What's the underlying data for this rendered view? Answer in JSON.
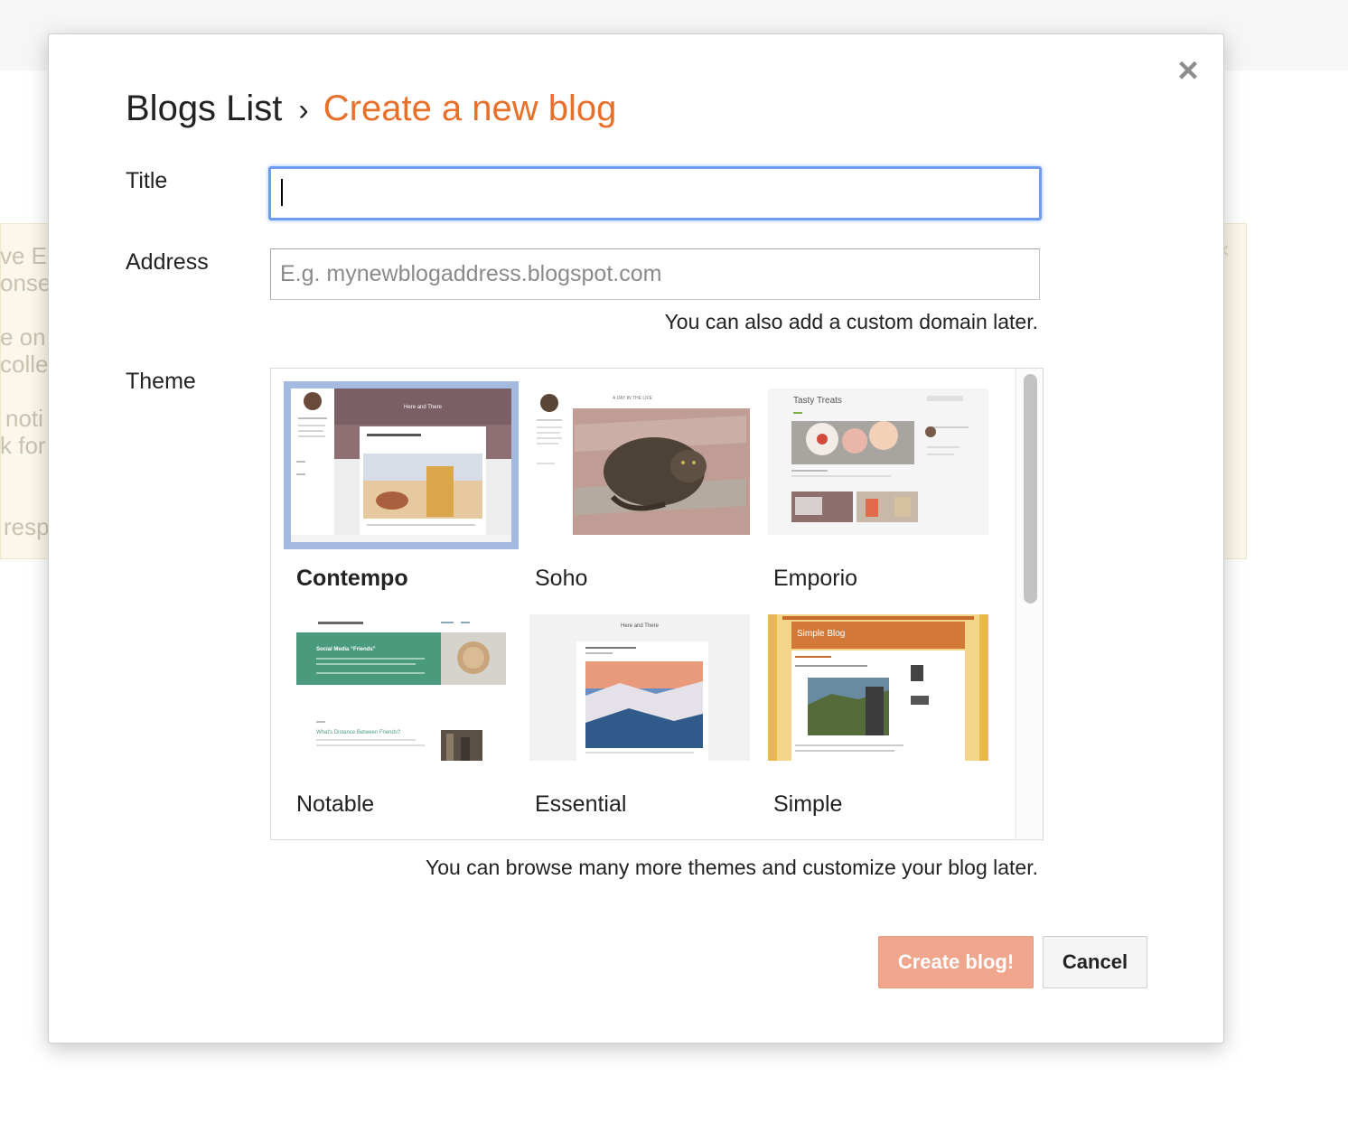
{
  "background": {
    "notice_lines": [
      "ve E",
      "onse",
      "e on y",
      "colle",
      "noti",
      "k for",
      "resp"
    ],
    "notice_close": "×"
  },
  "dialog": {
    "close_glyph": "×",
    "breadcrumb": {
      "root": "Blogs List",
      "separator": "›",
      "current": "Create a new blog"
    },
    "form": {
      "title_label": "Title",
      "title_value": "",
      "address_label": "Address",
      "address_value": "",
      "address_placeholder": "E.g. mynewblogaddress.blogspot.com",
      "address_hint": "You can also add a custom domain later.",
      "theme_label": "Theme",
      "theme_hint": "You can browse many more themes and customize your blog later."
    },
    "themes": [
      {
        "name": "Contempo",
        "selected": true
      },
      {
        "name": "Soho",
        "selected": false
      },
      {
        "name": "Emporio",
        "selected": false
      },
      {
        "name": "Notable",
        "selected": false
      },
      {
        "name": "Essential",
        "selected": false
      },
      {
        "name": "Simple",
        "selected": false
      }
    ],
    "thumb_text": {
      "contempo_header": "Here and There",
      "soho_header": "A DAY IN THE LIFE",
      "emporio_title": "Tasty Treats",
      "notable_card": "Social Media “Friends”",
      "notable_post": "What's Distance Between Friends?",
      "essential_header": "Here and There",
      "simple_title": "Simple Blog"
    },
    "buttons": {
      "create": "Create blog!",
      "cancel": "Cancel"
    },
    "colors": {
      "accent": "#e8702a",
      "create_button": "#f0a58d",
      "focus_border": "#6e9cf2",
      "selected_theme_border": "#a4badf"
    }
  }
}
